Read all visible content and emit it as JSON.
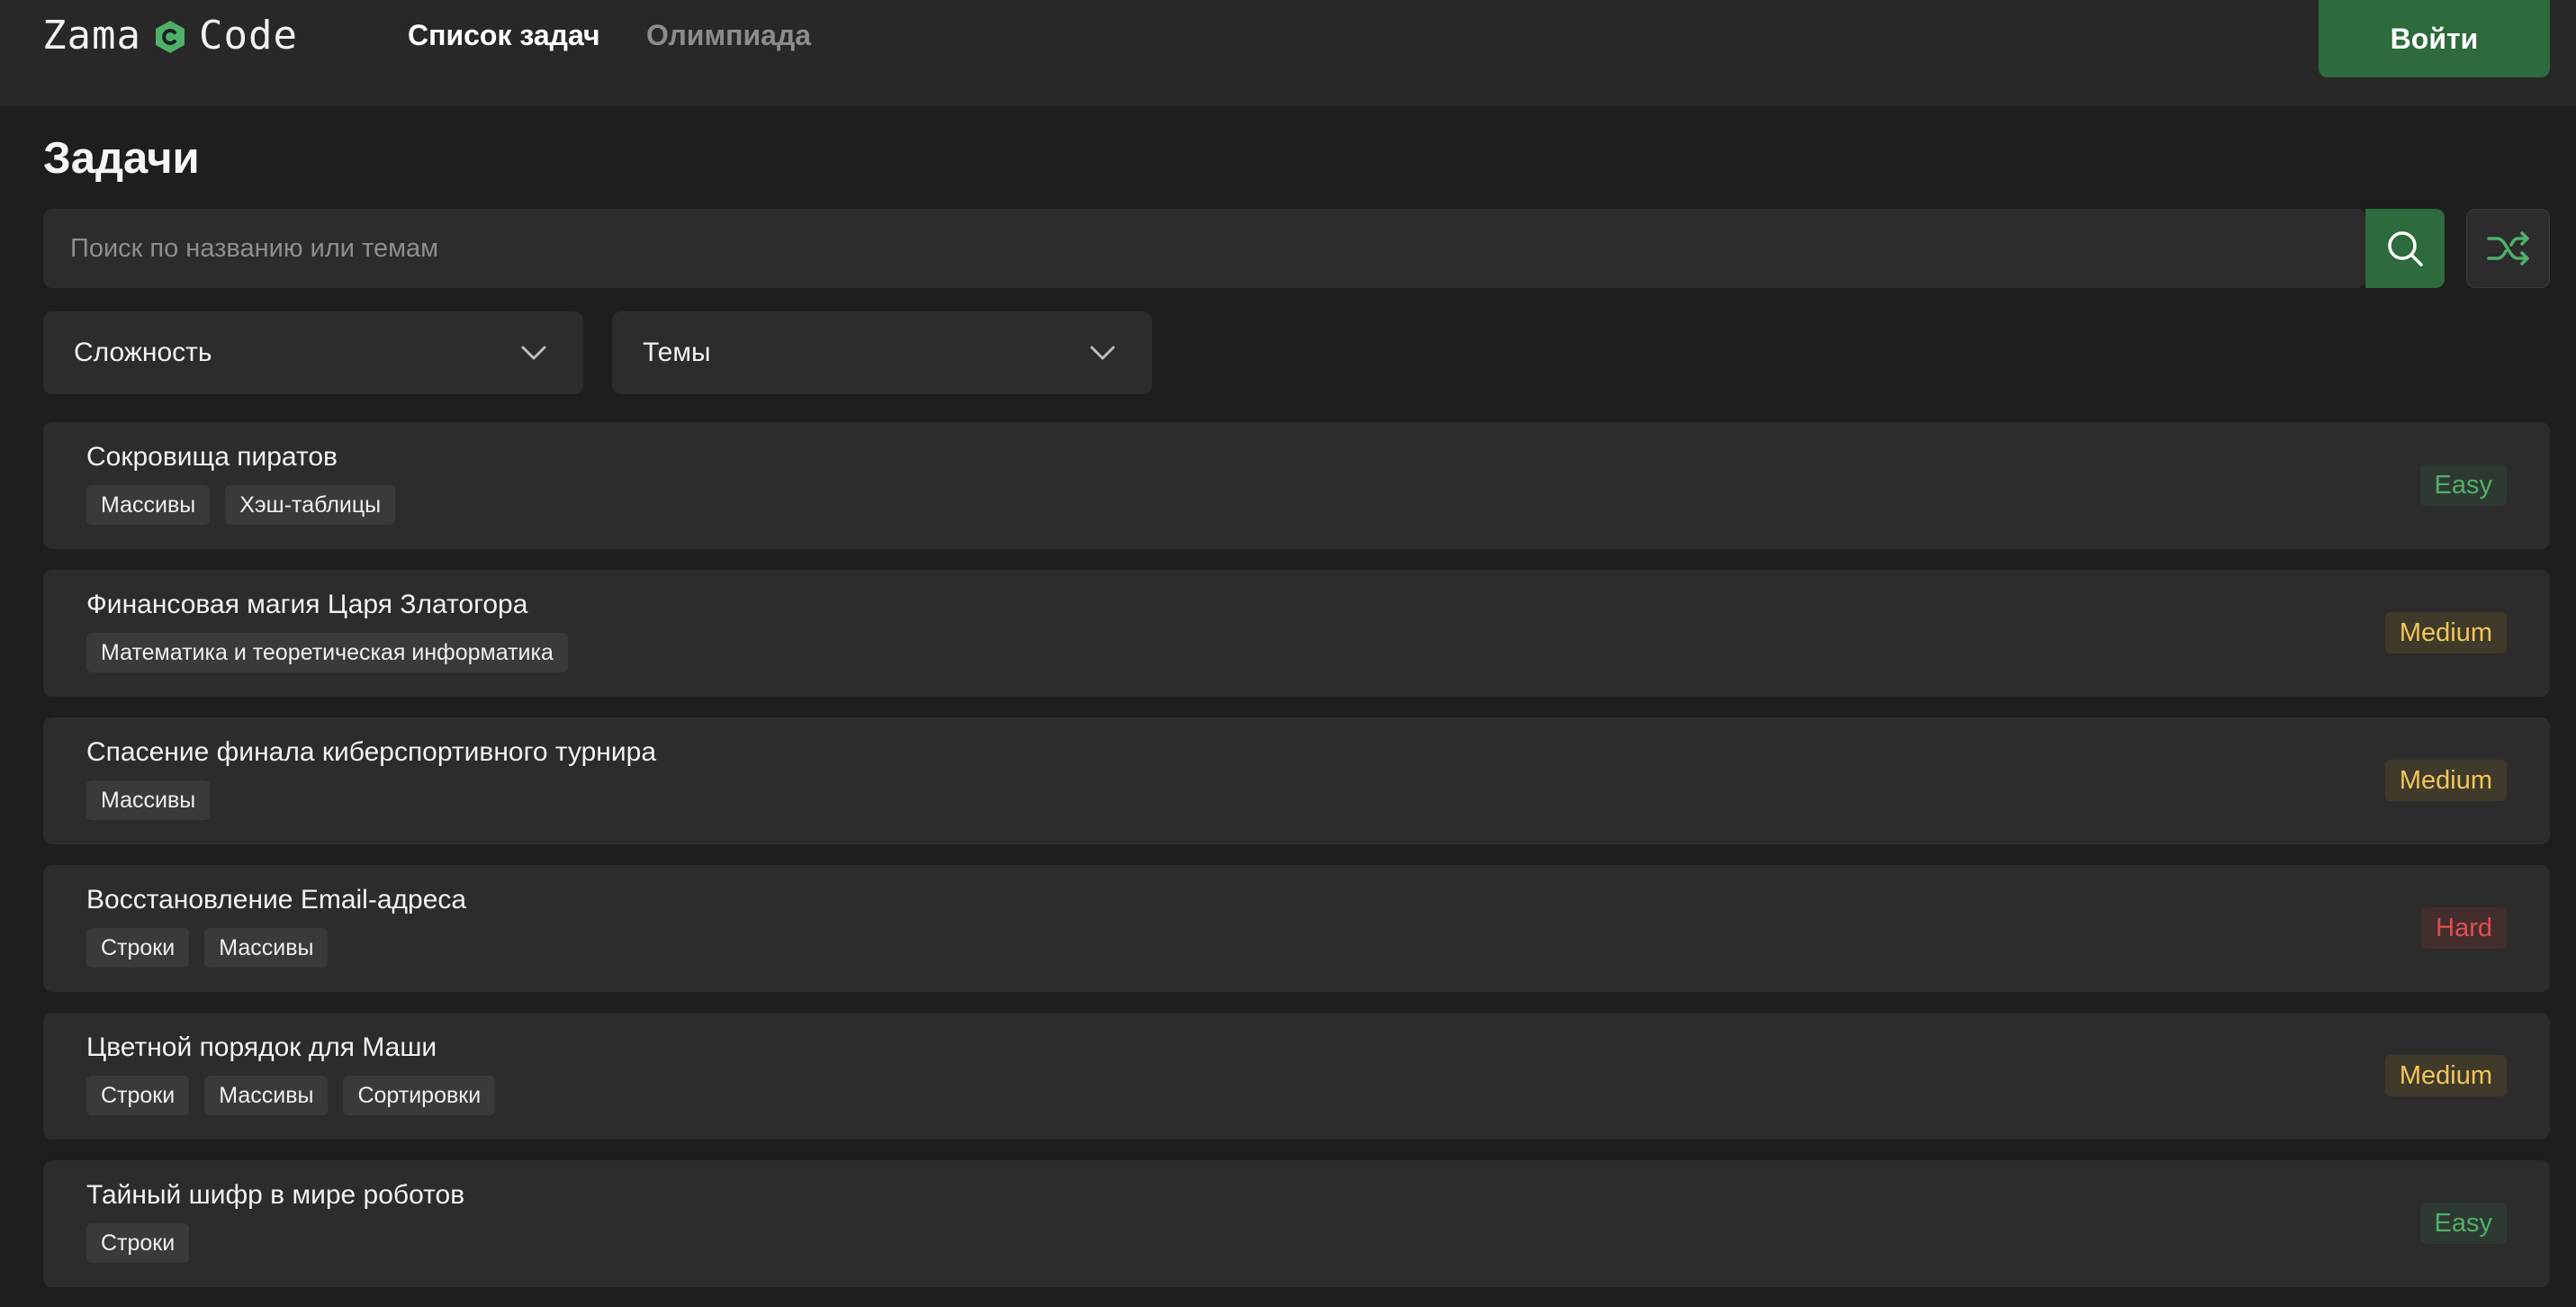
{
  "header": {
    "logo_left": "Zama",
    "logo_right": "Code",
    "logo_icon": "c-hexagon-icon",
    "nav": [
      {
        "label": "Список задач",
        "active": true
      },
      {
        "label": "Олимпиада",
        "active": false
      }
    ],
    "login_label": "Войти"
  },
  "page": {
    "title": "Задачи"
  },
  "search": {
    "placeholder": "Поиск по названию или темам",
    "value": "",
    "search_icon": "search-icon",
    "shuffle_icon": "shuffle-icon"
  },
  "filters": {
    "difficulty_label": "Сложность",
    "topics_label": "Темы"
  },
  "colors": {
    "accent": "#2d6a3c",
    "easy": "#4fb06a",
    "medium": "#f2c65a",
    "hard": "#e04f4f"
  },
  "tasks": [
    {
      "title": "Сокровища пиратов",
      "tags": [
        "Массивы",
        "Хэш-таблицы"
      ],
      "difficulty": "Easy"
    },
    {
      "title": "Финансовая магия Царя Златогора",
      "tags": [
        "Математика и теоретическая информатика"
      ],
      "difficulty": "Medium"
    },
    {
      "title": "Спасение финала киберспортивного турнира",
      "tags": [
        "Массивы"
      ],
      "difficulty": "Medium"
    },
    {
      "title": "Восстановление Email-адреса",
      "tags": [
        "Строки",
        "Массивы"
      ],
      "difficulty": "Hard"
    },
    {
      "title": "Цветной порядок для Маши",
      "tags": [
        "Строки",
        "Массивы",
        "Сортировки"
      ],
      "difficulty": "Medium"
    },
    {
      "title": "Тайный шифр в мире роботов",
      "tags": [
        "Строки"
      ],
      "difficulty": "Easy"
    }
  ]
}
